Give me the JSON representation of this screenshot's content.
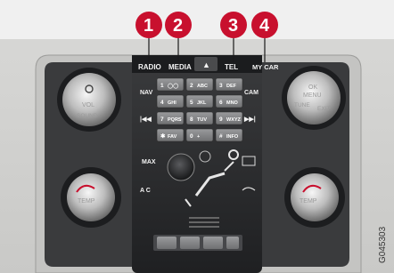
{
  "callouts": [
    "1",
    "2",
    "3",
    "4"
  ],
  "top_buttons": {
    "radio": "RADIO",
    "media": "MEDIA",
    "eject": "▲",
    "tel": "TEL",
    "mycar": "MY CAR"
  },
  "left_knob": {
    "vol": "VOL",
    "sound": "SOUND"
  },
  "right_knob": {
    "ok_menu": "OK\nMENU",
    "ok": "OK",
    "menu": "MENU",
    "tune": "TUNE",
    "exit": "EXIT"
  },
  "side_buttons": {
    "nav": "NAV",
    "cam": "CAM",
    "prev": "|◀◀",
    "next": "▶▶|",
    "ac": "A C",
    "max": "MAX"
  },
  "keypad": [
    {
      "digit": "1",
      "letters": "◯◯"
    },
    {
      "digit": "2",
      "letters": "ABC"
    },
    {
      "digit": "3",
      "letters": "DEF"
    },
    {
      "digit": "4",
      "letters": "GHI"
    },
    {
      "digit": "5",
      "letters": "JKL"
    },
    {
      "digit": "6",
      "letters": "MNO"
    },
    {
      "digit": "7",
      "letters": "PQRS"
    },
    {
      "digit": "8",
      "letters": "TUV"
    },
    {
      "digit": "9",
      "letters": "WXYZ"
    },
    {
      "digit": "✱",
      "letters": "FAV"
    },
    {
      "digit": "0",
      "letters": "+"
    },
    {
      "digit": "#",
      "letters": "INFO"
    }
  ],
  "temp_labels": {
    "left": "TEMP",
    "right": "TEMP"
  },
  "image_id": "G045303",
  "colors": {
    "callout": "#c8102e",
    "panel": "#2a2b2d",
    "frame": "#d4d4d2"
  }
}
